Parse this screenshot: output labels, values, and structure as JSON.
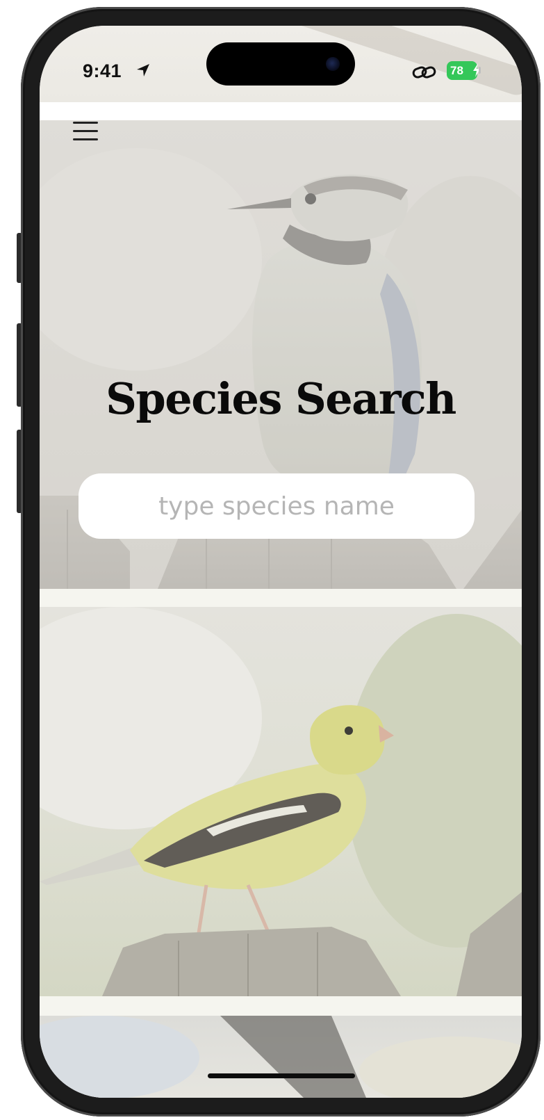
{
  "status_bar": {
    "time": "9:41",
    "location_icon": "location-arrow-icon",
    "link_icon": "link-icon",
    "battery_level": "78",
    "battery_charging": true,
    "battery_color": "#34c759"
  },
  "header": {
    "menu_icon": "hamburger-menu-icon"
  },
  "hero": {
    "title": "Species Search",
    "background_subject": "blue jay perched on a fence"
  },
  "search": {
    "value": "",
    "placeholder": "type species name"
  },
  "cards": [
    {
      "image_subject": "american goldfinch on a wooden post"
    },
    {
      "image_subject": "partially visible bird image"
    }
  ]
}
